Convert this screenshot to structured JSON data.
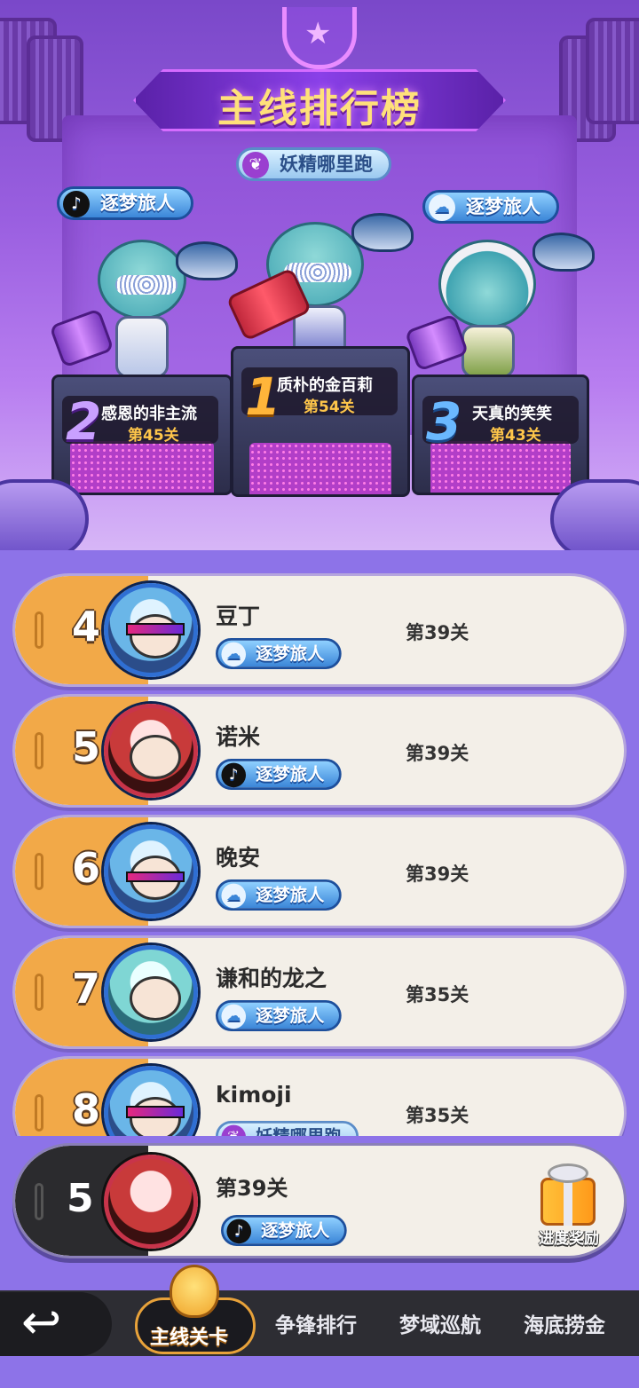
{
  "title": "主线排行榜",
  "top_badge": "妖精哪里跑",
  "podium": [
    {
      "rank": "2",
      "name": "感恩的非主流",
      "level": "第45关",
      "tag": "逐梦旅人",
      "tag_platform": "douyin"
    },
    {
      "rank": "1",
      "name": "质朴的金百莉",
      "level": "第54关"
    },
    {
      "rank": "3",
      "name": "天真的笑笑",
      "level": "第43关",
      "tag": "逐梦旅人",
      "tag_platform": "cloud"
    }
  ],
  "ranking": [
    {
      "rank": "4",
      "name": "豆丁",
      "level": "第39关",
      "tag": "逐梦旅人"
    },
    {
      "rank": "5",
      "name": "诺米",
      "level": "第39关",
      "tag": "逐梦旅人"
    },
    {
      "rank": "6",
      "name": "晚安",
      "level": "第39关",
      "tag": "逐梦旅人"
    },
    {
      "rank": "7",
      "name": "谦和的龙之",
      "level": "第35关",
      "tag": "逐梦旅人"
    },
    {
      "rank": "8",
      "name": "kimoji",
      "level": "第35关",
      "tag": "妖精哪里跑"
    }
  ],
  "self": {
    "rank": "5",
    "level": "第39关",
    "tag": "逐梦旅人",
    "reward_label": "进度奖励"
  },
  "nav": {
    "back_icon": "↩",
    "tabs": [
      "主线关卡",
      "争锋排行",
      "梦域巡航",
      "海底捞金"
    ],
    "active_index": 0
  },
  "icons": {
    "douyin": "♪",
    "cloud": "☁",
    "grape": "❦"
  },
  "colors": {
    "accent_orange": "#f2a948",
    "pill_blue": "#3b86d8",
    "gold": "#ffc64a"
  }
}
